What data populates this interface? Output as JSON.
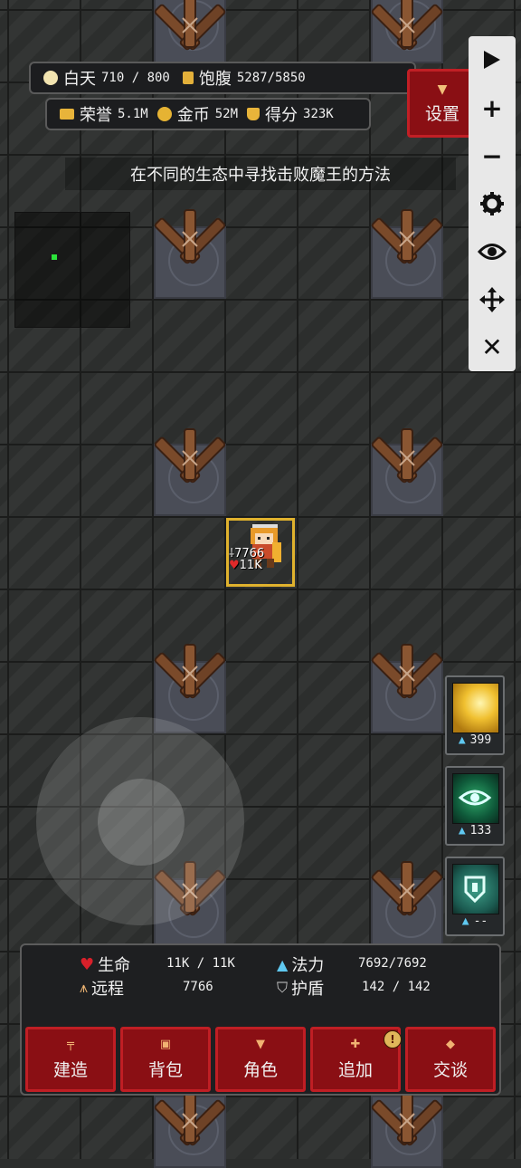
{
  "status": {
    "day_label": "白天",
    "day_value": "710 / 800",
    "food_label": "饱腹",
    "food_value": "5287/5850",
    "honor_label": "荣誉",
    "honor_value": "5.1M",
    "gold_label": "金币",
    "gold_value": "52M",
    "score_label": "得分",
    "score_value": "323K"
  },
  "settings_label": "设置",
  "hint_text": "在不同的生态中寻找击败魔王的方法",
  "toolbar": {
    "items": [
      "play-icon",
      "zoom-in-icon",
      "zoom-out-icon",
      "gear-icon",
      "eye-icon",
      "move-icon",
      "close-icon"
    ]
  },
  "hero": {
    "attack": "7766",
    "hp": "11K"
  },
  "skills": [
    {
      "name": "light-burst-skill",
      "cost": "399"
    },
    {
      "name": "eye-skill",
      "cost": "133"
    },
    {
      "name": "shield-skill",
      "cost": "--"
    }
  ],
  "stats": {
    "life_label": "生命",
    "life_value": "11K / 11K",
    "mana_label": "法力",
    "mana_value": "7692/7692",
    "ranged_label": "远程",
    "ranged_value": "7766",
    "shield_label": "护盾",
    "shield_value": "142 / 142"
  },
  "menu": {
    "build": "建造",
    "bag": "背包",
    "character": "角色",
    "add": "追加",
    "talk": "交谈",
    "add_badge": "!"
  },
  "colors": {
    "button_red": "#8a0f14",
    "button_border": "#c01e24",
    "gold": "#e0b22d",
    "minimap_dot": "#2be33a"
  }
}
